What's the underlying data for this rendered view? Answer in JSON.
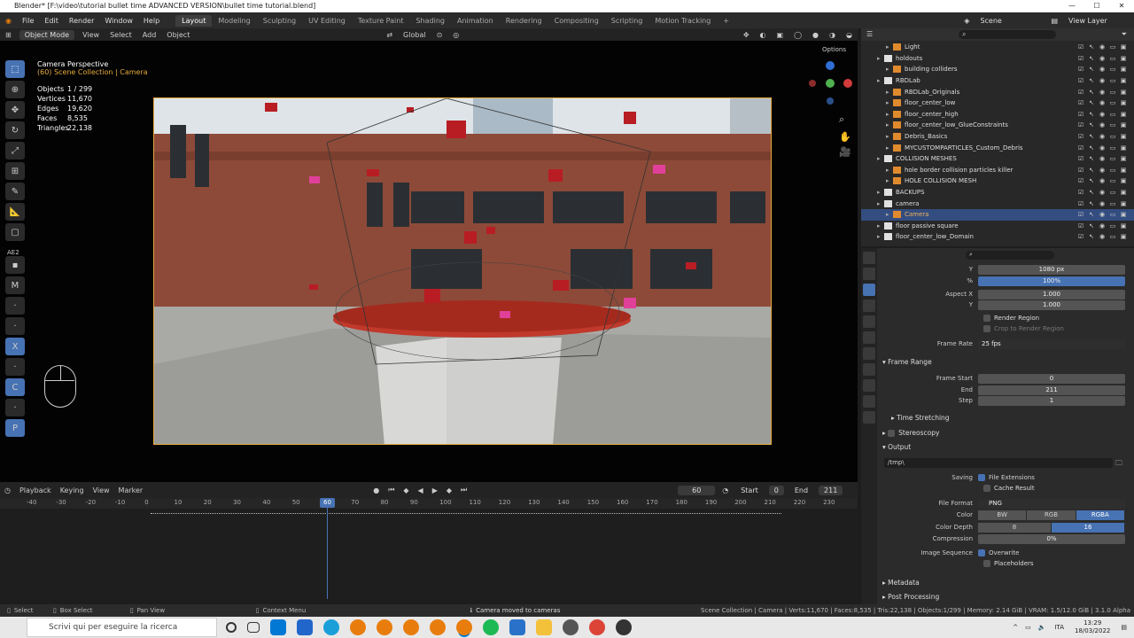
{
  "window": {
    "title": "Blender* [F:\\video\\tutorial bullet time ADVANCED VERSION\\bullet time tutorial.blend]"
  },
  "menu": [
    "File",
    "Edit",
    "Render",
    "Window",
    "Help"
  ],
  "workspaces": [
    "Layout",
    "Modeling",
    "Sculpting",
    "UV Editing",
    "Texture Paint",
    "Shading",
    "Animation",
    "Rendering",
    "Compositing",
    "Scripting",
    "Motion Tracking"
  ],
  "scene": {
    "scene_label": "Scene",
    "view_layer_label": "View Layer"
  },
  "viewport_header": {
    "mode": "Object Mode",
    "items": [
      "View",
      "Select",
      "Add",
      "Object"
    ],
    "orientation": "Global",
    "options": "Options"
  },
  "overlay": {
    "title": "Camera Perspective",
    "subtitle": "(60) Scene Collection | Camera",
    "stats": [
      {
        "k": "Objects",
        "v": "1 / 299"
      },
      {
        "k": "Vertices",
        "v": "11,670"
      },
      {
        "k": "Edges",
        "v": "19,620"
      },
      {
        "k": "Faces",
        "v": "8,535"
      },
      {
        "k": "Triangles",
        "v": "22,138"
      }
    ]
  },
  "side_panel": {
    "label": "AE2"
  },
  "timeline": {
    "menu": [
      "Playback",
      "Keying",
      "View",
      "Marker"
    ],
    "current_frame": "60",
    "start_label": "Start",
    "start": "0",
    "end_label": "End",
    "end": "211",
    "ticks": [
      "-40",
      "-30",
      "-20",
      "-10",
      "0",
      "10",
      "20",
      "30",
      "40",
      "50",
      "60",
      "70",
      "80",
      "90",
      "100",
      "110",
      "120",
      "130",
      "140",
      "150",
      "160",
      "170",
      "180",
      "190",
      "200",
      "210",
      "220",
      "230"
    ]
  },
  "outliner": {
    "rows": [
      {
        "name": "Light",
        "indent": 2,
        "selected": false
      },
      {
        "name": "holdouts",
        "indent": 1,
        "selected": false
      },
      {
        "name": "building colliders",
        "indent": 2,
        "selected": false
      },
      {
        "name": "RBDLab",
        "indent": 1,
        "selected": false
      },
      {
        "name": "RBDLab_Originals",
        "indent": 2,
        "selected": false
      },
      {
        "name": "floor_center_low",
        "indent": 2,
        "selected": false
      },
      {
        "name": "floor_center_high",
        "indent": 2,
        "selected": false
      },
      {
        "name": "floor_center_low_GlueConstraints",
        "indent": 2,
        "selected": false
      },
      {
        "name": "Debris_Basics",
        "indent": 2,
        "selected": false
      },
      {
        "name": "MYCUSTOMPARTICLES_Custom_Debris",
        "indent": 2,
        "selected": false
      },
      {
        "name": "COLLISION MESHES",
        "indent": 1,
        "selected": false
      },
      {
        "name": "hole border collision particles killer",
        "indent": 2,
        "selected": false
      },
      {
        "name": "HOLE COLLISION MESH",
        "indent": 2,
        "selected": false
      },
      {
        "name": "BACKUPS",
        "indent": 1,
        "selected": false
      },
      {
        "name": "camera",
        "indent": 1,
        "selected": false
      },
      {
        "name": "Camera",
        "indent": 2,
        "selected": true
      },
      {
        "name": "floor passive square",
        "indent": 1,
        "selected": false
      },
      {
        "name": "floor_center_low_Domain",
        "indent": 1,
        "selected": false
      }
    ]
  },
  "properties": {
    "res_y": {
      "label": "Y",
      "value": "1080 px"
    },
    "percent": {
      "label": "%",
      "value": "100%"
    },
    "aspect_x": {
      "label": "Aspect X",
      "value": "1.000"
    },
    "aspect_y": {
      "label": "Y",
      "value": "1.000"
    },
    "render_region": "Render Region",
    "crop_region": "Crop to Render Region",
    "frame_rate": {
      "label": "Frame Rate",
      "value": "25 fps"
    },
    "frame_range": {
      "title": "Frame Range",
      "start_label": "Frame Start",
      "start": "0",
      "end_label": "End",
      "end": "211",
      "step_label": "Step",
      "step": "1"
    },
    "time_stretching": "Time Stretching",
    "stereoscopy": "Stereoscopy",
    "output": {
      "title": "Output",
      "path": "/tmp\\",
      "saving_label": "Saving",
      "file_ext": "File Extensions",
      "cache_result": "Cache Result",
      "file_format_label": "File Format",
      "file_format": "PNG",
      "color_label": "Color",
      "color_opts": [
        "BW",
        "RGB",
        "RGBA"
      ],
      "depth_label": "Color Depth",
      "depth_opts": [
        "8",
        "16"
      ],
      "compression_label": "Compression",
      "compression": "0%",
      "image_seq_label": "Image Sequence",
      "overwrite": "Overwrite",
      "placeholders": "Placeholders"
    },
    "metadata": "Metadata",
    "post_processing": "Post Processing"
  },
  "statusbar": {
    "select": "Select",
    "box_select": "Box Select",
    "pan_view": "Pan View",
    "context_menu": "Context Menu",
    "message": "Camera moved to cameras",
    "info": "Scene Collection | Camera | Verts:11,670 | Faces:8,535 | Tris:22,138 | Objects:1/299 | Memory: 2.14 GiB | VRAM: 1.5/12.0 GiB | 3.1.0 Alpha"
  },
  "taskbar": {
    "search_placeholder": "Scrivi qui per eseguire la ricerca",
    "lang": "ITA",
    "time": "13:29",
    "date": "18/03/2022"
  }
}
